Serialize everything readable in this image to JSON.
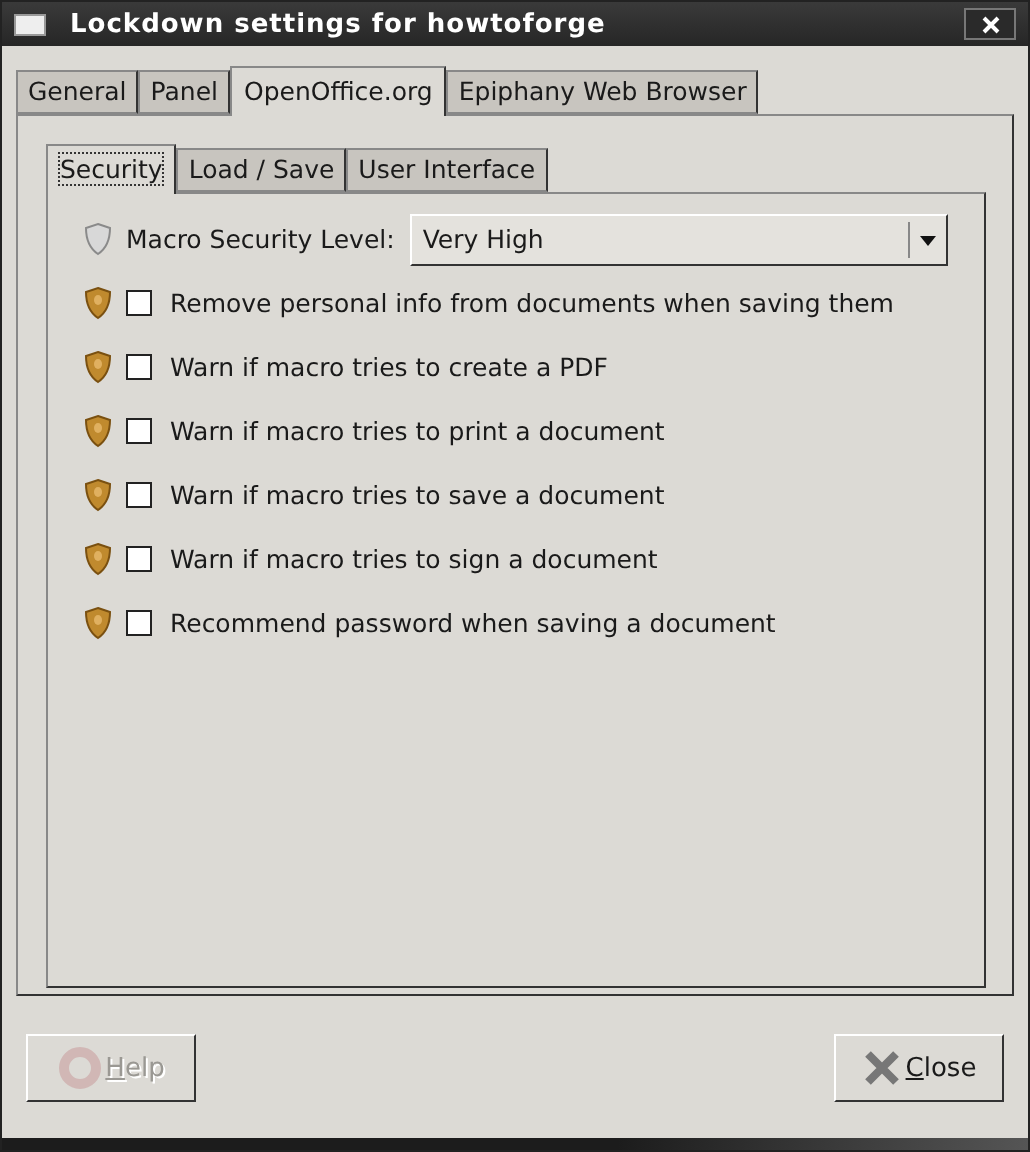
{
  "window": {
    "title": "Lockdown settings for howtoforge"
  },
  "tabs": [
    {
      "label": "General",
      "selected": false
    },
    {
      "label": "Panel",
      "selected": false
    },
    {
      "label": "OpenOffice.org",
      "selected": true
    },
    {
      "label": "Epiphany Web Browser",
      "selected": false
    }
  ],
  "subtabs": [
    {
      "label": "Security",
      "selected": true
    },
    {
      "label": "Load / Save",
      "selected": false
    },
    {
      "label": "User Interface",
      "selected": false
    }
  ],
  "macro_level": {
    "label": "Macro Security Level:",
    "value": "Very High",
    "locked": false
  },
  "options": [
    {
      "label": "Remove personal info from documents when saving them",
      "checked": false,
      "locked": true
    },
    {
      "label": "Warn if macro tries to create a PDF",
      "checked": false,
      "locked": true
    },
    {
      "label": "Warn if macro tries to print a document",
      "checked": false,
      "locked": true
    },
    {
      "label": "Warn if macro tries to save a document",
      "checked": false,
      "locked": true
    },
    {
      "label": "Warn if macro tries to sign a document",
      "checked": false,
      "locked": true
    },
    {
      "label": "Recommend password when saving a document",
      "checked": false,
      "locked": true
    }
  ],
  "buttons": [
    {
      "kind": "help",
      "label": "Help",
      "disabled": true
    },
    {
      "kind": "close",
      "label": "Close",
      "disabled": false
    }
  ]
}
